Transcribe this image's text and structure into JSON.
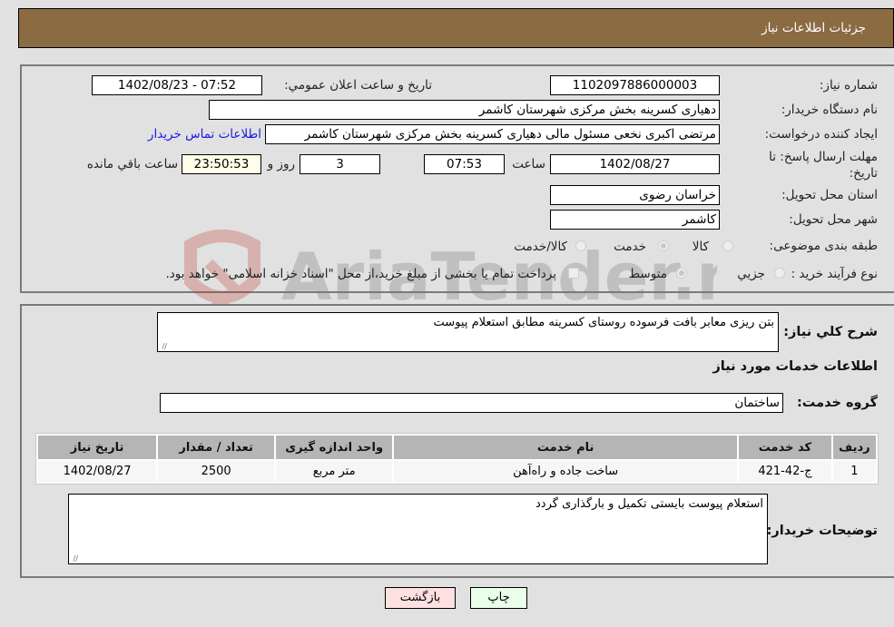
{
  "header": {
    "title": "جزئیات اطلاعات نیاز"
  },
  "details": {
    "need_number_label": "شماره نیاز:",
    "need_number": "1102097886000003",
    "announce_label": "تاریخ و ساعت اعلان عمومي:",
    "announce_value": "1402/08/23 - 07:52",
    "buyer_org_label": "نام دستگاه خریدار:",
    "buyer_org": "دهیاری کسرینه بخش مرکزی شهرستان کاشمر",
    "creator_label": "ایجاد کننده درخواست:",
    "creator": "مرتضی اکبری نخعی مسئول مالی دهیاری کسرینه بخش مرکزی شهرستان کاشمر",
    "contact_link": "اطلاعات تماس خریدار",
    "deadline_label_line1": "مهلت ارسال پاسخ: تا",
    "deadline_label_line2": "تاریخ:",
    "deadline_date": "1402/08/27",
    "time_label": "ساعت",
    "deadline_time": "07:53",
    "days_value": "3",
    "days_label": "روز و",
    "remaining_time": "23:50:53",
    "remaining_label": "ساعت باقي مانده",
    "province_label": "استان محل تحویل:",
    "province": "خراسان رضوی",
    "city_label": "شهر محل تحویل:",
    "city": "کاشمر",
    "category_label": "طبقه بندی موضوعی:",
    "category_options": [
      {
        "label": "کالا",
        "selected": false
      },
      {
        "label": "خدمت",
        "selected": true
      },
      {
        "label": "کالا/خدمت",
        "selected": false
      }
    ],
    "process_label": "نوع فرآیند خرید :",
    "process_options": [
      {
        "label": "جزيي",
        "selected": false
      },
      {
        "label": "متوسط",
        "selected": true
      }
    ],
    "treasury_note": "پرداخت تمام یا بخشی از مبلغ خرید،از محل \"اسناد خزانه اسلامی\" خواهد بود.",
    "treasury_checked": false
  },
  "summary": {
    "description_label": "شرح کلي نیاز:",
    "description": "بتن ریزی معابر بافت فرسوده روستای کسرینه مطابق استعلام پیوست",
    "services_heading": "اطلاعات خدمات مورد نیاز",
    "service_group_label": "گروه خدمت:",
    "service_group": "ساختمان",
    "table": {
      "headers": [
        "ردیف",
        "کد خدمت",
        "نام خدمت",
        "واحد اندازه گیری",
        "تعداد / مقدار",
        "تاریخ نیاز"
      ],
      "rows": [
        [
          "1",
          "ج-42-421",
          "ساخت جاده و راه‌آهن",
          "متر مربع",
          "2500",
          "1402/08/27"
        ]
      ]
    },
    "buyer_notes_label": "توضیحات خریدار:",
    "buyer_notes": "استعلام پیوست بایستی تکمیل و بارگذاری گردد"
  },
  "buttons": {
    "print": "چاپ",
    "back": "بازگشت"
  },
  "watermark": {
    "text": "AriaTender.neT"
  }
}
